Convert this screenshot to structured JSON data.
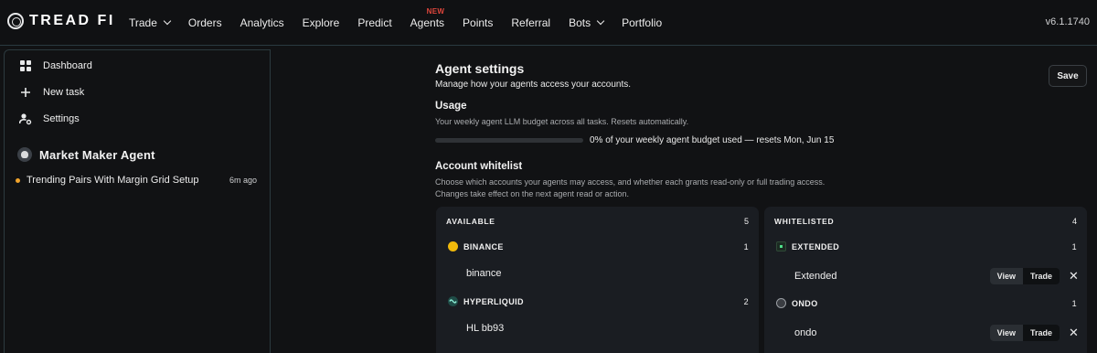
{
  "brand": {
    "name": "TREAD FI"
  },
  "nav": {
    "items": [
      {
        "label": "Trade",
        "dropdown": true
      },
      {
        "label": "Orders"
      },
      {
        "label": "Analytics"
      },
      {
        "label": "Explore"
      },
      {
        "label": "Predict"
      },
      {
        "label": "Agents",
        "badge": "NEW"
      },
      {
        "label": "Points"
      },
      {
        "label": "Referral"
      },
      {
        "label": "Bots",
        "dropdown": true
      },
      {
        "label": "Portfolio"
      }
    ],
    "version": "v6.1.1740"
  },
  "sidebar": {
    "links": [
      {
        "label": "Dashboard",
        "icon": "dashboard-grid-icon"
      },
      {
        "label": "New task",
        "icon": "plus-icon"
      },
      {
        "label": "Settings",
        "icon": "user-settings-icon"
      }
    ],
    "agent": {
      "name": "Market Maker Agent",
      "icon": "agent-avatar-icon"
    },
    "tasks": [
      {
        "name": "Trending Pairs With Margin Grid Setup",
        "time": "6m ago",
        "status_color": "#f0a32c"
      }
    ]
  },
  "settings": {
    "title": "Agent settings",
    "subtitle": "Manage how your agents access your accounts.",
    "save_label": "Save",
    "usage": {
      "title": "Usage",
      "description": "Your weekly agent LLM budget across all tasks. Resets automatically.",
      "percent_used": 0,
      "status_text": "0% of your weekly agent budget used — resets Mon, Jun 15"
    },
    "whitelist": {
      "title": "Account whitelist",
      "description_line1": "Choose which accounts your agents may access, and whether each grants read-only or full trading access.",
      "description_line2": "Changes take effect on the next agent read or action."
    }
  },
  "available": {
    "header": "AVAILABLE",
    "count": "5",
    "exchanges": [
      {
        "name": "BINANCE",
        "count": "1",
        "icon": "binance-icon",
        "accounts": [
          "binance"
        ]
      },
      {
        "name": "HYPERLIQUID",
        "count": "2",
        "icon": "hyperliquid-icon",
        "accounts": [
          "HL bb93"
        ]
      }
    ]
  },
  "whitelisted": {
    "header": "WHITELISTED",
    "count": "4",
    "exchanges": [
      {
        "name": "EXTENDED",
        "count": "1",
        "icon": "extended-icon",
        "accounts": [
          {
            "name": "Extended",
            "view": "View",
            "trade": "Trade",
            "active": "view"
          }
        ]
      },
      {
        "name": "ONDO",
        "count": "1",
        "icon": "ondo-icon",
        "accounts": [
          {
            "name": "ondo",
            "view": "View",
            "trade": "Trade",
            "active": "view"
          }
        ]
      }
    ]
  },
  "colors": {
    "accent_green": "#3fb27f",
    "new_badge": "#e0463c",
    "task_status": "#f0a32c",
    "binance": "#f0b90b",
    "hyperliquid": "#1f4c47",
    "extended": "#1c2a22",
    "ondo": "#3a3d42"
  }
}
